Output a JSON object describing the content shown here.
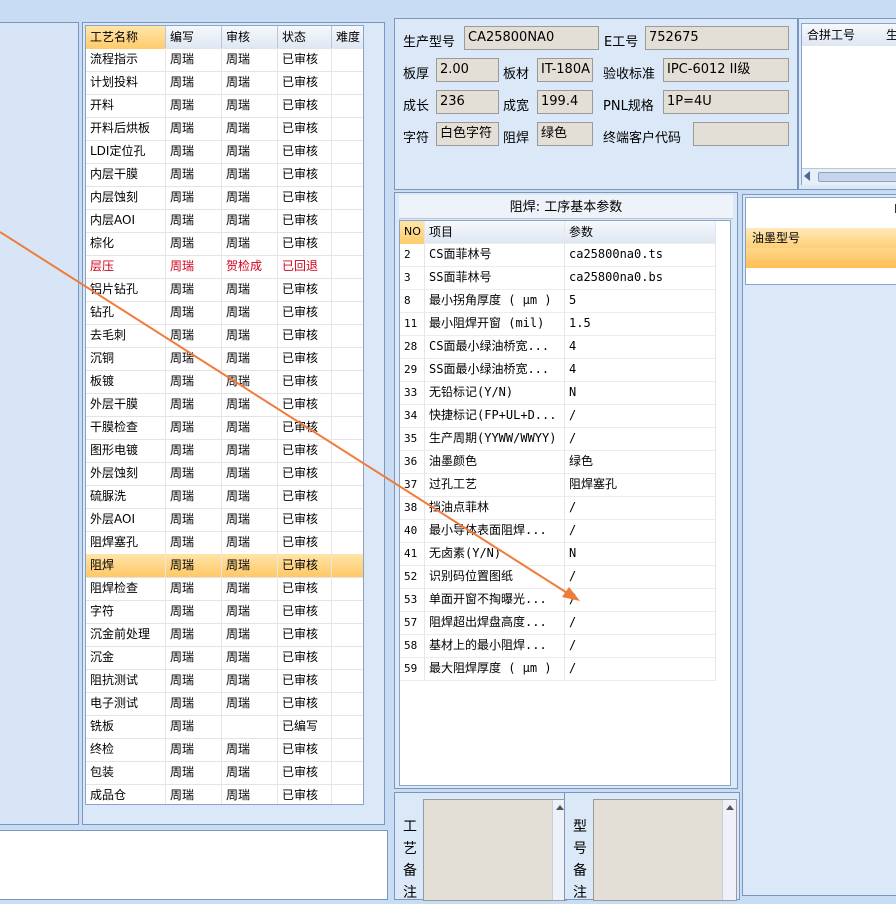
{
  "process_table": {
    "columns": [
      "工艺名称",
      "编写",
      "审核",
      "状态",
      "难度"
    ],
    "rows": [
      {
        "name": "流程指示",
        "writer": "周瑞",
        "reviewer": "周瑞",
        "status": "已审核",
        "diff": ""
      },
      {
        "name": "计划投料",
        "writer": "周瑞",
        "reviewer": "周瑞",
        "status": "已审核",
        "diff": ""
      },
      {
        "name": "开料",
        "writer": "周瑞",
        "reviewer": "周瑞",
        "status": "已审核",
        "diff": ""
      },
      {
        "name": "开料后烘板",
        "writer": "周瑞",
        "reviewer": "周瑞",
        "status": "已审核",
        "diff": ""
      },
      {
        "name": "LDI定位孔",
        "writer": "周瑞",
        "reviewer": "周瑞",
        "status": "已审核",
        "diff": ""
      },
      {
        "name": "内层干膜",
        "writer": "周瑞",
        "reviewer": "周瑞",
        "status": "已审核",
        "diff": ""
      },
      {
        "name": "内层蚀刻",
        "writer": "周瑞",
        "reviewer": "周瑞",
        "status": "已审核",
        "diff": ""
      },
      {
        "name": "内层AOI",
        "writer": "周瑞",
        "reviewer": "周瑞",
        "status": "已审核",
        "diff": ""
      },
      {
        "name": "棕化",
        "writer": "周瑞",
        "reviewer": "周瑞",
        "status": "已审核",
        "diff": ""
      },
      {
        "name": "层压",
        "writer": "周瑞",
        "reviewer": "贺检成",
        "status": "已回退",
        "diff": ""
      },
      {
        "name": "铝片钻孔",
        "writer": "周瑞",
        "reviewer": "周瑞",
        "status": "已审核",
        "diff": ""
      },
      {
        "name": "钻孔",
        "writer": "周瑞",
        "reviewer": "周瑞",
        "status": "已审核",
        "diff": ""
      },
      {
        "name": "去毛刺",
        "writer": "周瑞",
        "reviewer": "周瑞",
        "status": "已审核",
        "diff": ""
      },
      {
        "name": "沉铜",
        "writer": "周瑞",
        "reviewer": "周瑞",
        "status": "已审核",
        "diff": ""
      },
      {
        "name": "板镀",
        "writer": "周瑞",
        "reviewer": "周瑞",
        "status": "已审核",
        "diff": ""
      },
      {
        "name": "外层干膜",
        "writer": "周瑞",
        "reviewer": "周瑞",
        "status": "已审核",
        "diff": ""
      },
      {
        "name": "干膜检查",
        "writer": "周瑞",
        "reviewer": "周瑞",
        "status": "已审核",
        "diff": ""
      },
      {
        "name": "图形电镀",
        "writer": "周瑞",
        "reviewer": "周瑞",
        "status": "已审核",
        "diff": ""
      },
      {
        "name": "外层蚀刻",
        "writer": "周瑞",
        "reviewer": "周瑞",
        "status": "已审核",
        "diff": ""
      },
      {
        "name": "硫脲洗",
        "writer": "周瑞",
        "reviewer": "周瑞",
        "status": "已审核",
        "diff": ""
      },
      {
        "name": "外层AOI",
        "writer": "周瑞",
        "reviewer": "周瑞",
        "status": "已审核",
        "diff": ""
      },
      {
        "name": "阻焊塞孔",
        "writer": "周瑞",
        "reviewer": "周瑞",
        "status": "已审核",
        "diff": ""
      },
      {
        "name": "阻焊",
        "writer": "周瑞",
        "reviewer": "周瑞",
        "status": "已审核",
        "diff": ""
      },
      {
        "name": "阻焊检查",
        "writer": "周瑞",
        "reviewer": "周瑞",
        "status": "已审核",
        "diff": ""
      },
      {
        "name": "字符",
        "writer": "周瑞",
        "reviewer": "周瑞",
        "status": "已审核",
        "diff": ""
      },
      {
        "name": "沉金前处理",
        "writer": "周瑞",
        "reviewer": "周瑞",
        "status": "已审核",
        "diff": ""
      },
      {
        "name": "沉金",
        "writer": "周瑞",
        "reviewer": "周瑞",
        "status": "已审核",
        "diff": ""
      },
      {
        "name": "阻抗测试",
        "writer": "周瑞",
        "reviewer": "周瑞",
        "status": "已审核",
        "diff": ""
      },
      {
        "name": "电子测试",
        "writer": "周瑞",
        "reviewer": "周瑞",
        "status": "已审核",
        "diff": ""
      },
      {
        "name": "铣板",
        "writer": "周瑞",
        "reviewer": "",
        "status": "已编写",
        "diff": ""
      },
      {
        "name": "终检",
        "writer": "周瑞",
        "reviewer": "周瑞",
        "status": "已审核",
        "diff": ""
      },
      {
        "name": "包装",
        "writer": "周瑞",
        "reviewer": "周瑞",
        "status": "已审核",
        "diff": ""
      },
      {
        "name": "成品仓",
        "writer": "周瑞",
        "reviewer": "周瑞",
        "status": "已审核",
        "diff": ""
      }
    ]
  },
  "info": {
    "model_label": "生产型号",
    "model_value": "CA25800NA0",
    "e_label": "E工号",
    "e_value": "752675",
    "thick_label": "板厚",
    "thick_value": "2.00",
    "material_label": "板材",
    "material_value": "IT-180A",
    "standard_label": "验收标准",
    "standard_value": "IPC-6012 II级",
    "length_label": "成长",
    "length_value": "236",
    "width_label": "成宽",
    "width_value": "199.4",
    "pnl_label": "PNL规格",
    "pnl_value": "1P=4U",
    "char_label": "字符",
    "char_value": "白色字符",
    "mask_label": "阻焊",
    "mask_value": "绿色",
    "customer_label": "终端客户代码",
    "customer_value": ""
  },
  "merge": {
    "col1": "合拼工号",
    "col2": "生"
  },
  "params": {
    "title": "阻焊: 工序基本参数",
    "columns": [
      "NO",
      "项目",
      "参数"
    ],
    "rows": [
      {
        "no": "2",
        "item": "CS面菲林号",
        "value": "ca25800na0.ts"
      },
      {
        "no": "3",
        "item": "SS面菲林号",
        "value": "ca25800na0.bs"
      },
      {
        "no": "8",
        "item": "最小拐角厚度 ( μm )",
        "value": "5"
      },
      {
        "no": "11",
        "item": "最小阻焊开窗 (mil)",
        "value": "1.5"
      },
      {
        "no": "28",
        "item": "CS面最小绿油桥宽...",
        "value": "4"
      },
      {
        "no": "29",
        "item": "SS面最小绿油桥宽...",
        "value": "4"
      },
      {
        "no": "33",
        "item": "无铅标记(Y/N)",
        "value": "N"
      },
      {
        "no": "34",
        "item": "快捷标记(FP+UL+D...",
        "value": "/"
      },
      {
        "no": "35",
        "item": "生产周期(YYWW/WWYY)",
        "value": "/"
      },
      {
        "no": "36",
        "item": "油墨颜色",
        "value": "绿色"
      },
      {
        "no": "37",
        "item": "过孔工艺",
        "value": "阻焊塞孔"
      },
      {
        "no": "38",
        "item": "挡油点菲林",
        "value": "/"
      },
      {
        "no": "40",
        "item": "最小导体表面阻焊...",
        "value": "/"
      },
      {
        "no": "41",
        "item": "无卤素(Y/N)",
        "value": "N"
      },
      {
        "no": "52",
        "item": "识别码位置图纸",
        "value": "/"
      },
      {
        "no": "53",
        "item": "单面开窗不掏曝光...",
        "value": "/"
      },
      {
        "no": "57",
        "item": "阻焊超出焊盘高度...",
        "value": "/"
      },
      {
        "no": "58",
        "item": "基材上的最小阻焊...",
        "value": "/"
      },
      {
        "no": "59",
        "item": "最大阻焊厚度 ( μm )",
        "value": "/"
      }
    ]
  },
  "right_panel": {
    "title_partial": "I",
    "ink_label": "油墨型号"
  },
  "notes": {
    "process_note": [
      "工",
      "艺",
      "备",
      "注"
    ],
    "model_note": [
      "型",
      "号",
      "备",
      "注"
    ]
  },
  "colors": {
    "selected_row": "#ffc866",
    "rejected": "#d0001c",
    "arrow": "#f07c3a",
    "panel_bg": "#dbe8f8"
  }
}
